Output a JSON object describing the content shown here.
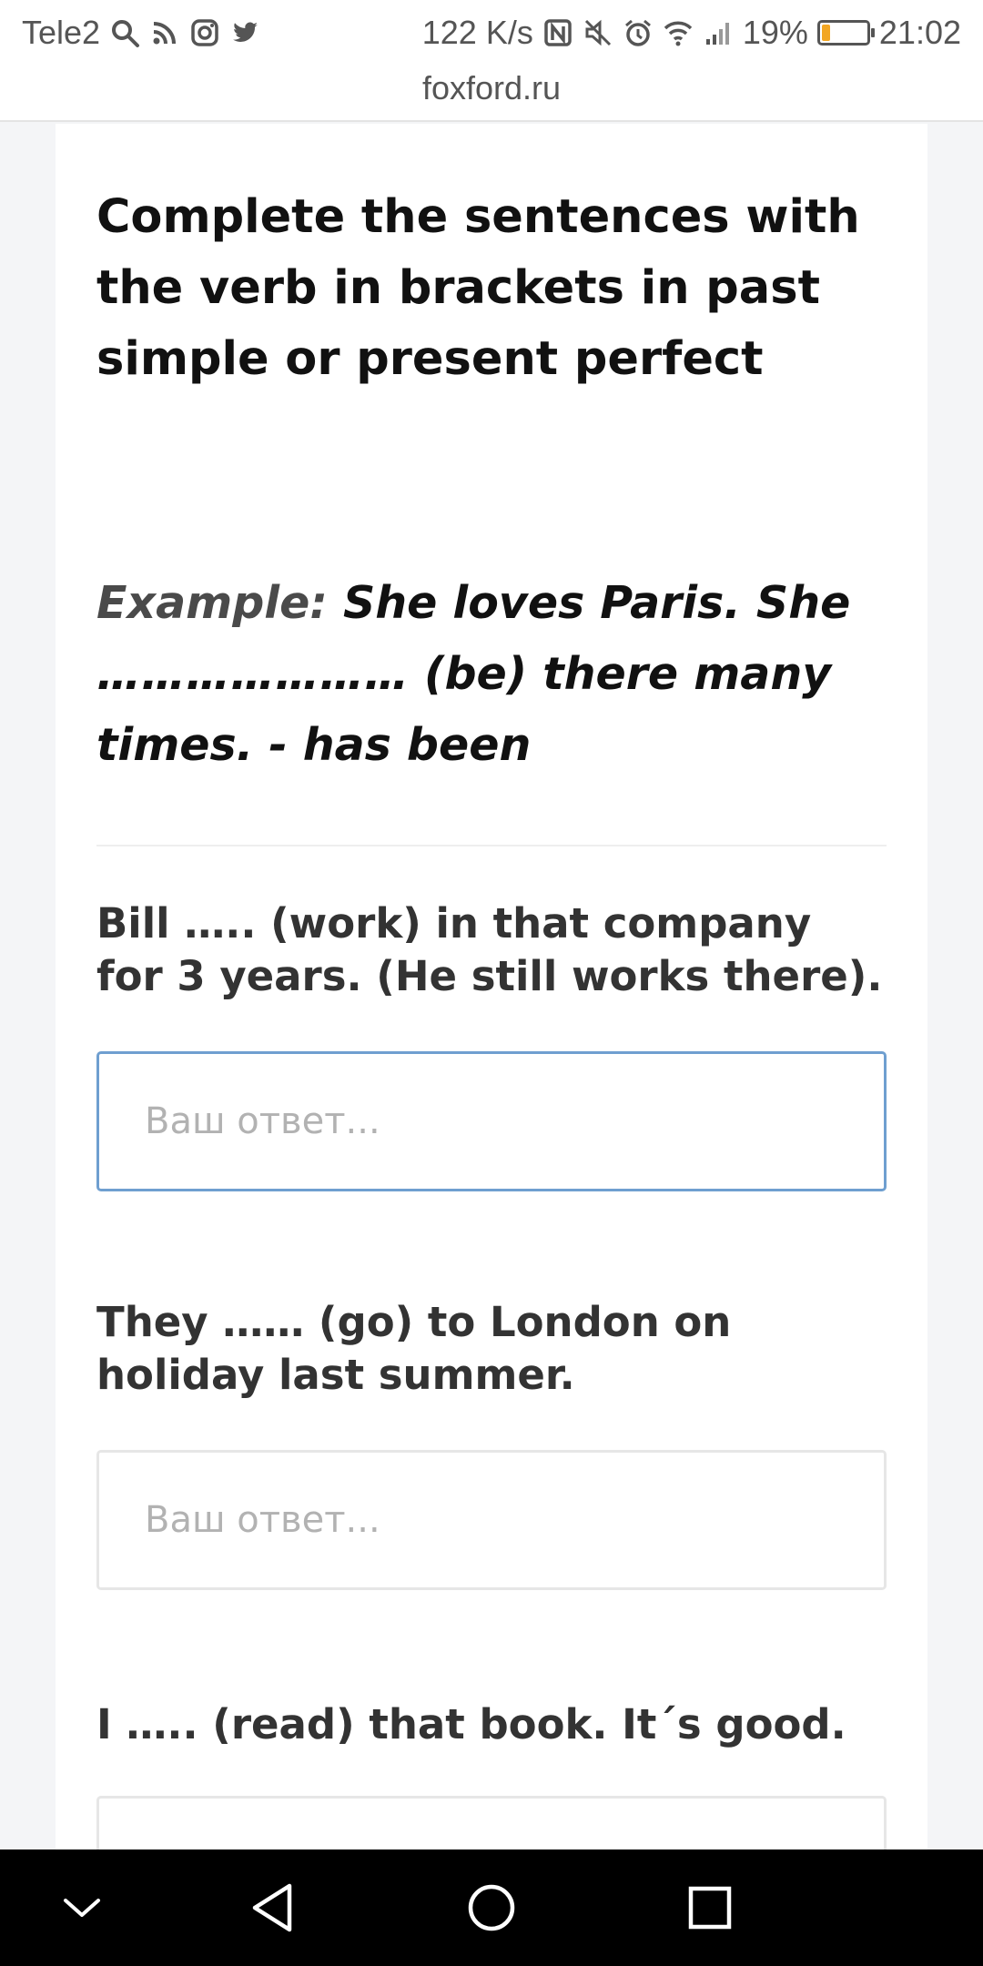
{
  "status_bar": {
    "carrier": "Tele2",
    "left_icons": [
      "search-icon",
      "rss-icon",
      "instagram-icon",
      "twitter-icon"
    ],
    "network_speed": "122 K/s",
    "right_icons": [
      "nfc-icon",
      "mute-icon",
      "alarm-icon",
      "wifi-icon",
      "signal-icon"
    ],
    "battery_percent": "19%",
    "battery_level": 0.19,
    "time": "21:02"
  },
  "browser": {
    "url": "foxford.ru"
  },
  "content": {
    "title": "Complete the sentences with the verb in brackets in past simple or present perfect",
    "example_label": "Example:",
    "example_text": " She loves Paris. She ………………… (be) there many times. - has been",
    "questions": [
      {
        "text": "Bill ….. (work) in that company for 3 years. (He still works there).",
        "placeholder": "Ваш ответ...",
        "value": ""
      },
      {
        "text": "They …… (go) to London on holiday last summer.",
        "placeholder": "Ваш ответ...",
        "value": ""
      },
      {
        "text": "I ….. (read) that book. It´s good.",
        "placeholder": "",
        "value": ""
      }
    ]
  },
  "navigation": {
    "icons": [
      "chevron-down-icon",
      "back-icon",
      "home-icon",
      "recents-icon"
    ]
  },
  "colors": {
    "focus_border": "#6f9fd0",
    "battery_fill": "#f2a623",
    "text_dark": "#111111"
  }
}
